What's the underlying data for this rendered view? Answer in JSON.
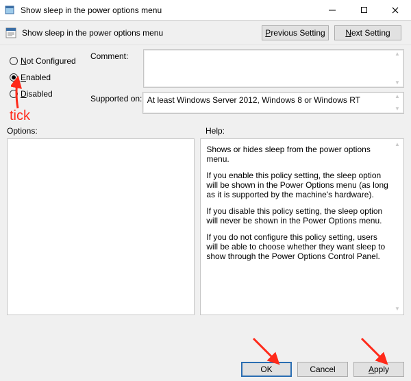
{
  "window": {
    "title": "Show sleep in the power options menu",
    "minimize_aria": "Minimize",
    "maximize_aria": "Maximize",
    "close_aria": "Close"
  },
  "subtitle": "Show sleep in the power options menu",
  "nav": {
    "prev": "Previous Setting",
    "next": "Next Setting"
  },
  "radios": {
    "not_configured": "Not Configured",
    "enabled": "Enabled",
    "disabled": "Disabled",
    "selected": "enabled"
  },
  "labels": {
    "comment": "Comment:",
    "supported_on": "Supported on:",
    "options": "Options:",
    "help": "Help:"
  },
  "comment_value": "",
  "supported_on_value": "At least Windows Server 2012, Windows 8 or Windows RT",
  "help": {
    "p1": "Shows or hides sleep from the power options menu.",
    "p2": "If you enable this policy setting, the sleep option will be shown in the Power Options menu (as long as it is supported by the machine's hardware).",
    "p3": "If you disable this policy setting, the sleep option will never be shown in the Power Options menu.",
    "p4": "If you do not configure this policy setting, users will be able to choose whether they want sleep to show through the Power Options Control Panel."
  },
  "buttons": {
    "ok": "OK",
    "cancel": "Cancel",
    "apply": "Apply"
  },
  "annotations": {
    "tick": "tick"
  }
}
